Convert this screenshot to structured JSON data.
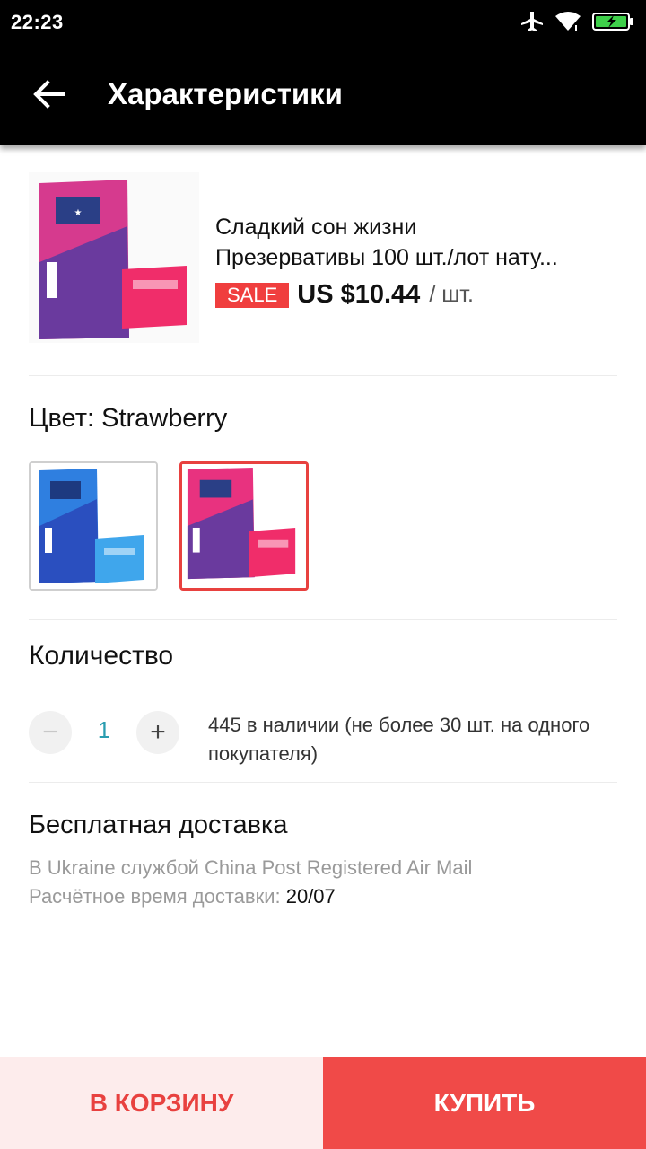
{
  "status_bar": {
    "time": "22:23",
    "icons": [
      "airplane-icon",
      "wifi-icon",
      "battery-charging-icon"
    ]
  },
  "app_bar": {
    "title": "Характеристики",
    "back_icon": "arrow-left-icon"
  },
  "product": {
    "name_line1": "Сладкий сон жизни",
    "name_line2": "Презервативы 100 шт./лот нату...",
    "sale_badge": "SALE",
    "price": "US $10.44",
    "per_unit": "/ шт."
  },
  "color": {
    "label": "Цвет: Strawberry",
    "options": [
      {
        "name": "blue",
        "selected": false,
        "color": "#2f7fe0"
      },
      {
        "name": "strawberry",
        "selected": true,
        "color": "#e8327f"
      }
    ]
  },
  "quantity": {
    "label": "Количество",
    "value": "1",
    "minus": "−",
    "plus": "+",
    "stock_line1": "445 в наличии (не более 30 шт. на одного",
    "stock_line2": "покупателя)"
  },
  "shipping": {
    "title": "Бесплатная доставка",
    "line1": "В Ukraine службой China Post Registered Air Mail",
    "line2_label": "Расчётное время доставки: ",
    "line2_date": "20/07"
  },
  "buttons": {
    "cart": "В КОРЗИНУ",
    "buy": "КУПИТЬ"
  },
  "colors": {
    "accent": "#f04a48",
    "cart_bg": "#fdecec",
    "qty_value": "#2a9db0"
  }
}
